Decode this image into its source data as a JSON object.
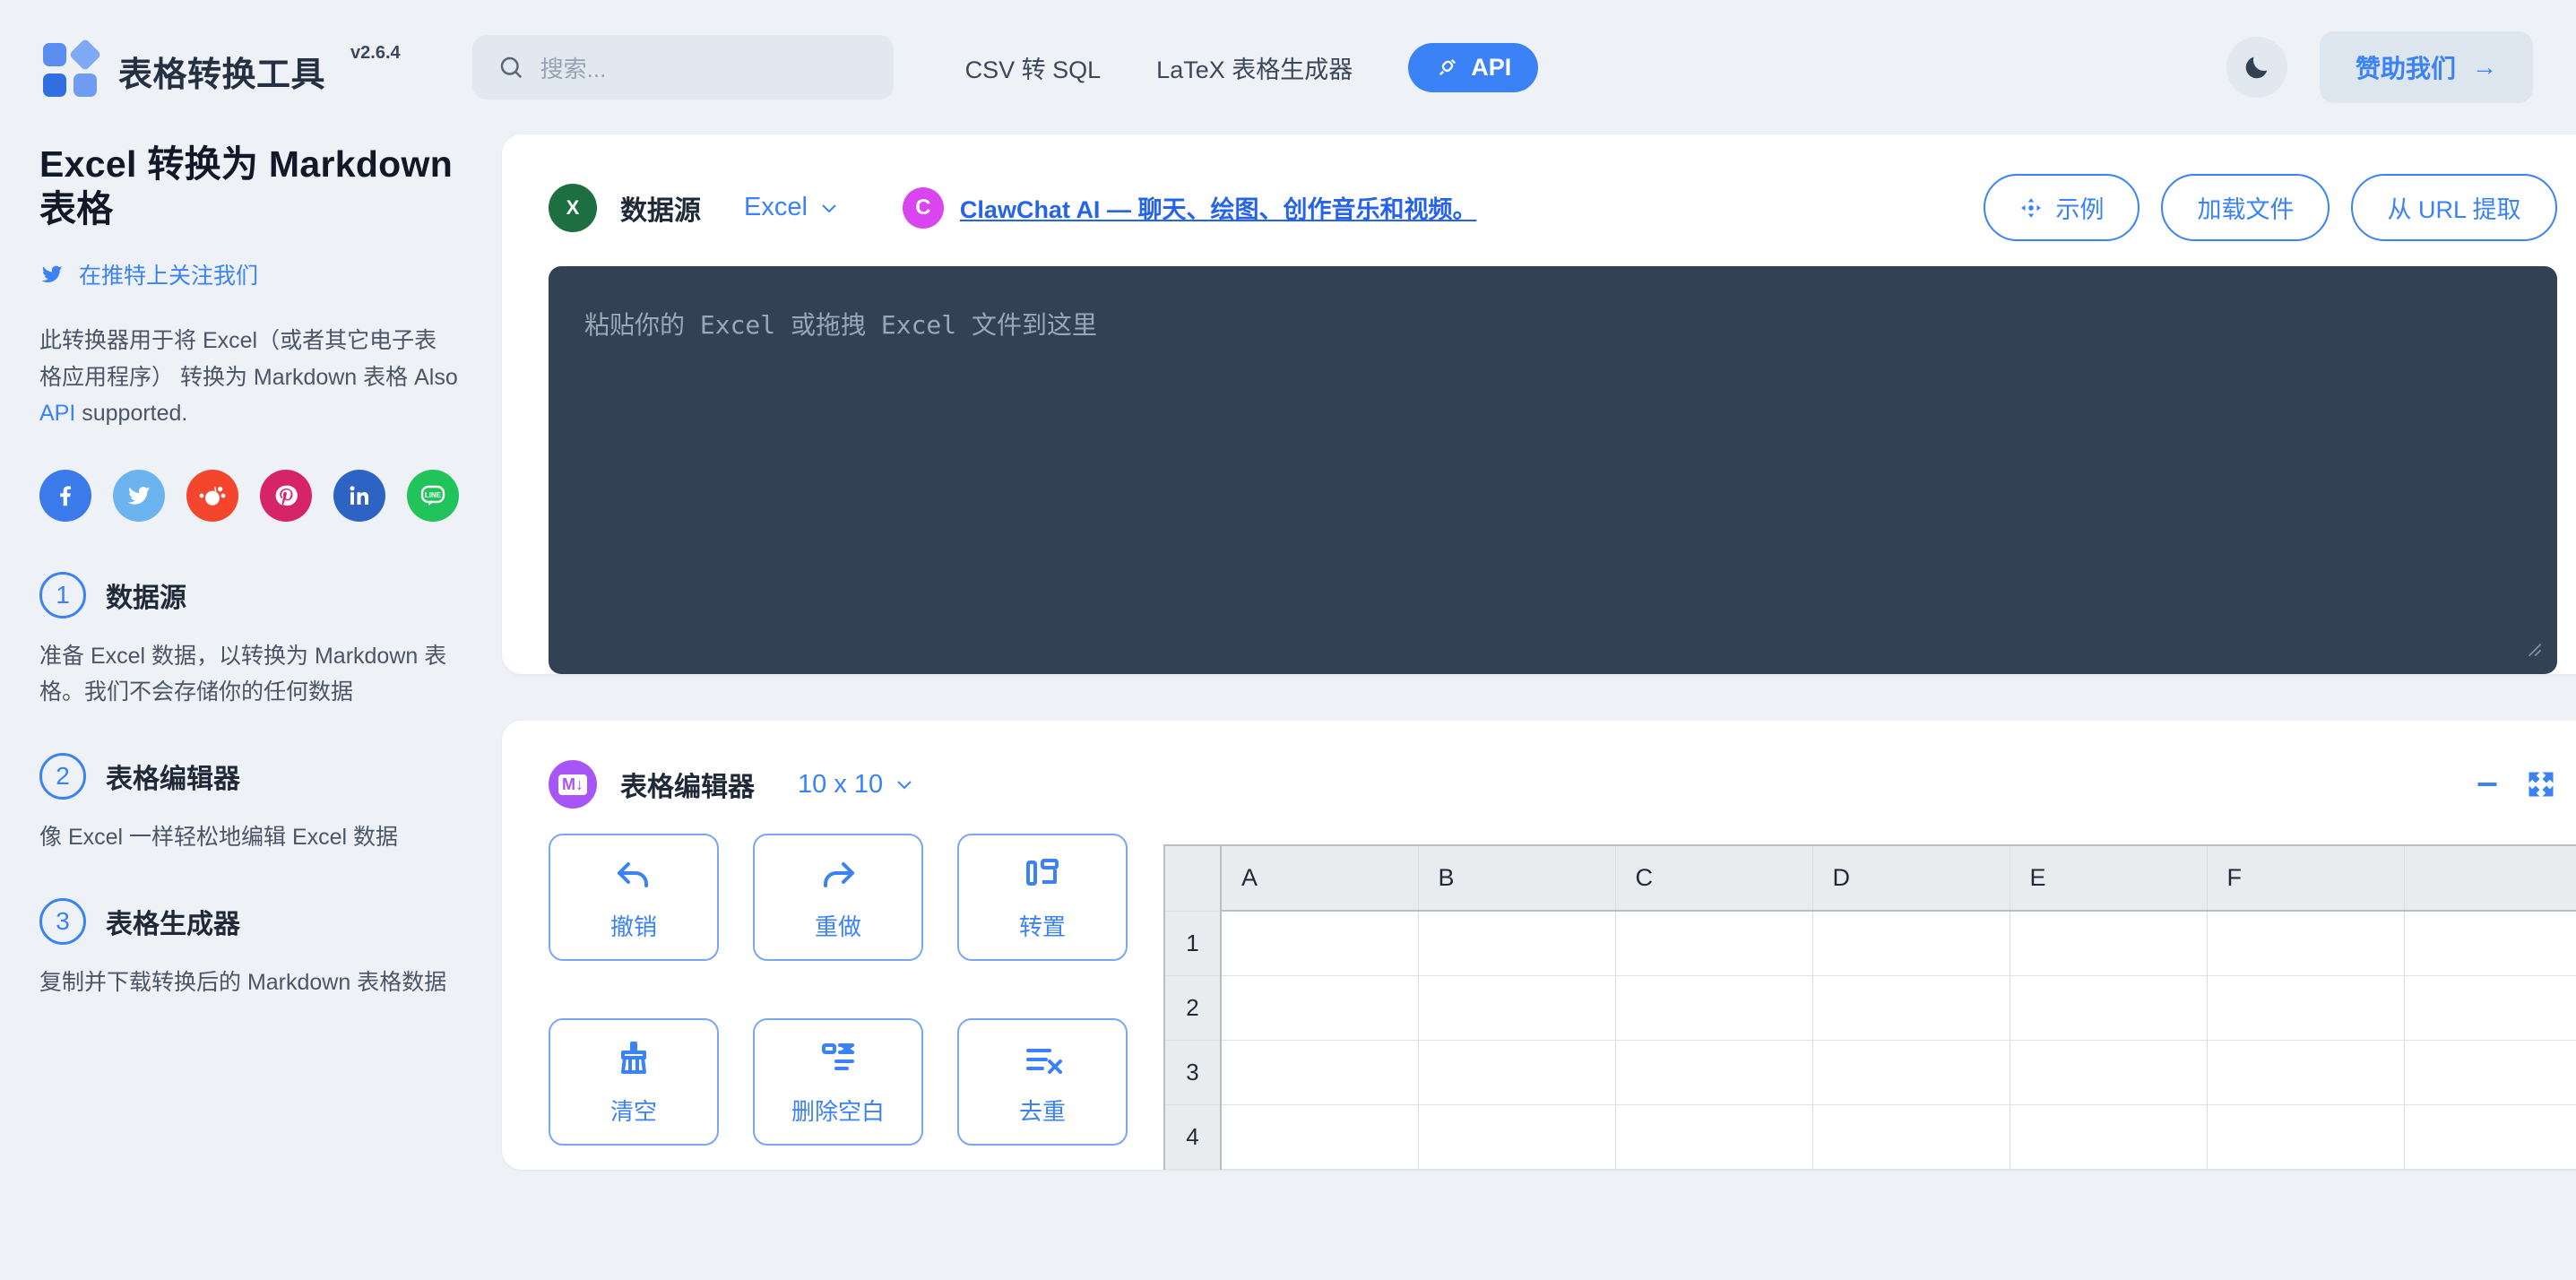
{
  "header": {
    "brand_title": "表格转换工具",
    "version": "v2.6.4",
    "search_placeholder": "搜索...",
    "search_icon": "search-icon",
    "nav": [
      {
        "label": "CSV 转 SQL"
      },
      {
        "label": "LaTeX 表格生成器"
      }
    ],
    "api_label": "API",
    "api_icon": "plug-icon",
    "theme_icon": "moon-icon",
    "sponsor_label": "赞助我们",
    "sponsor_arrow": "→"
  },
  "sidebar": {
    "page_title": "Excel 转换为 Markdown 表格",
    "twitter_label": "在推特上关注我们",
    "twitter_icon": "twitter-icon",
    "desc_part1": "此转换器用于将 Excel（或者其它电子表格应用程序） 转换为 Markdown 表格 Also ",
    "desc_link": "API",
    "desc_part2": " supported.",
    "socials": [
      {
        "name": "facebook",
        "glyph": "f",
        "color": "#3b7aea"
      },
      {
        "name": "twitter",
        "glyph": "✒",
        "color": "#6cb4f0"
      },
      {
        "name": "reddit",
        "glyph": "●",
        "color": "#f4452d"
      },
      {
        "name": "pinterest",
        "glyph": "ᴘ",
        "color": "#d62469"
      },
      {
        "name": "linkedin",
        "glyph": "in",
        "color": "#2d64c4"
      },
      {
        "name": "line",
        "glyph": "LINE",
        "color": "#21c45a"
      }
    ],
    "steps": [
      {
        "num": "1",
        "title": "数据源",
        "desc": "准备 Excel 数据，以转换为 Markdown 表格。我们不会存储你的任何数据"
      },
      {
        "num": "2",
        "title": "表格编辑器",
        "desc": "像 Excel 一样轻松地编辑 Excel 数据"
      },
      {
        "num": "3",
        "title": "表格生成器",
        "desc": "复制并下载转换后的 Markdown 表格数据"
      }
    ]
  },
  "datasource_card": {
    "icon_name": "excel-icon",
    "icon_glyph": "X",
    "title": "数据源",
    "format_value": "Excel",
    "chevron": "∨",
    "promo_avatar": "C",
    "promo_link": "ClawChat AI — 聊天、绘图、创作音乐和视频。",
    "buttons": [
      {
        "name": "example-button",
        "label": "示例",
        "icon": "shuffle-icon"
      },
      {
        "name": "load-file-button",
        "label": "加载文件",
        "icon": ""
      },
      {
        "name": "extract-url-button",
        "label": "从 URL 提取",
        "icon": ""
      }
    ],
    "textarea_placeholder": "粘贴你的 Excel 或拖拽 Excel 文件到这里",
    "textarea_value": ""
  },
  "editor_card": {
    "icon_name": "markdown-icon",
    "icon_glyph": "M↓",
    "title": "表格编辑器",
    "size_value": "10 x 10",
    "chevron": "∨",
    "minimize_icon": "minus-icon",
    "fullscreen_icon": "expand-icon",
    "tools": [
      {
        "name": "undo-button",
        "label": "撤销",
        "icon": "undo-icon"
      },
      {
        "name": "redo-button",
        "label": "重做",
        "icon": "redo-icon"
      },
      {
        "name": "transpose-button",
        "label": "转置",
        "icon": "transpose-icon"
      },
      {
        "name": "clear-button",
        "label": "清空",
        "icon": "broom-icon"
      },
      {
        "name": "remove-blank-button",
        "label": "删除空白",
        "icon": "remove-blank-icon"
      },
      {
        "name": "dedupe-button",
        "label": "去重",
        "icon": "dedupe-icon"
      }
    ],
    "sheet": {
      "columns": [
        "A",
        "B",
        "C",
        "D",
        "E",
        "F",
        ""
      ],
      "rows": [
        {
          "num": "1",
          "cells": [
            "",
            "",
            "",
            "",
            "",
            "",
            ""
          ]
        },
        {
          "num": "2",
          "cells": [
            "",
            "",
            "",
            "",
            "",
            "",
            ""
          ]
        },
        {
          "num": "3",
          "cells": [
            "",
            "",
            "",
            "",
            "",
            "",
            ""
          ]
        },
        {
          "num": "4",
          "cells": [
            "",
            "",
            "",
            "",
            "",
            "",
            ""
          ]
        }
      ]
    }
  },
  "colors": {
    "accent": "#3b82f6",
    "page_bg": "#eef2f7",
    "textarea_bg": "#334155",
    "excel_green": "#1d6f42",
    "markdown_purple": "#a855f7"
  }
}
